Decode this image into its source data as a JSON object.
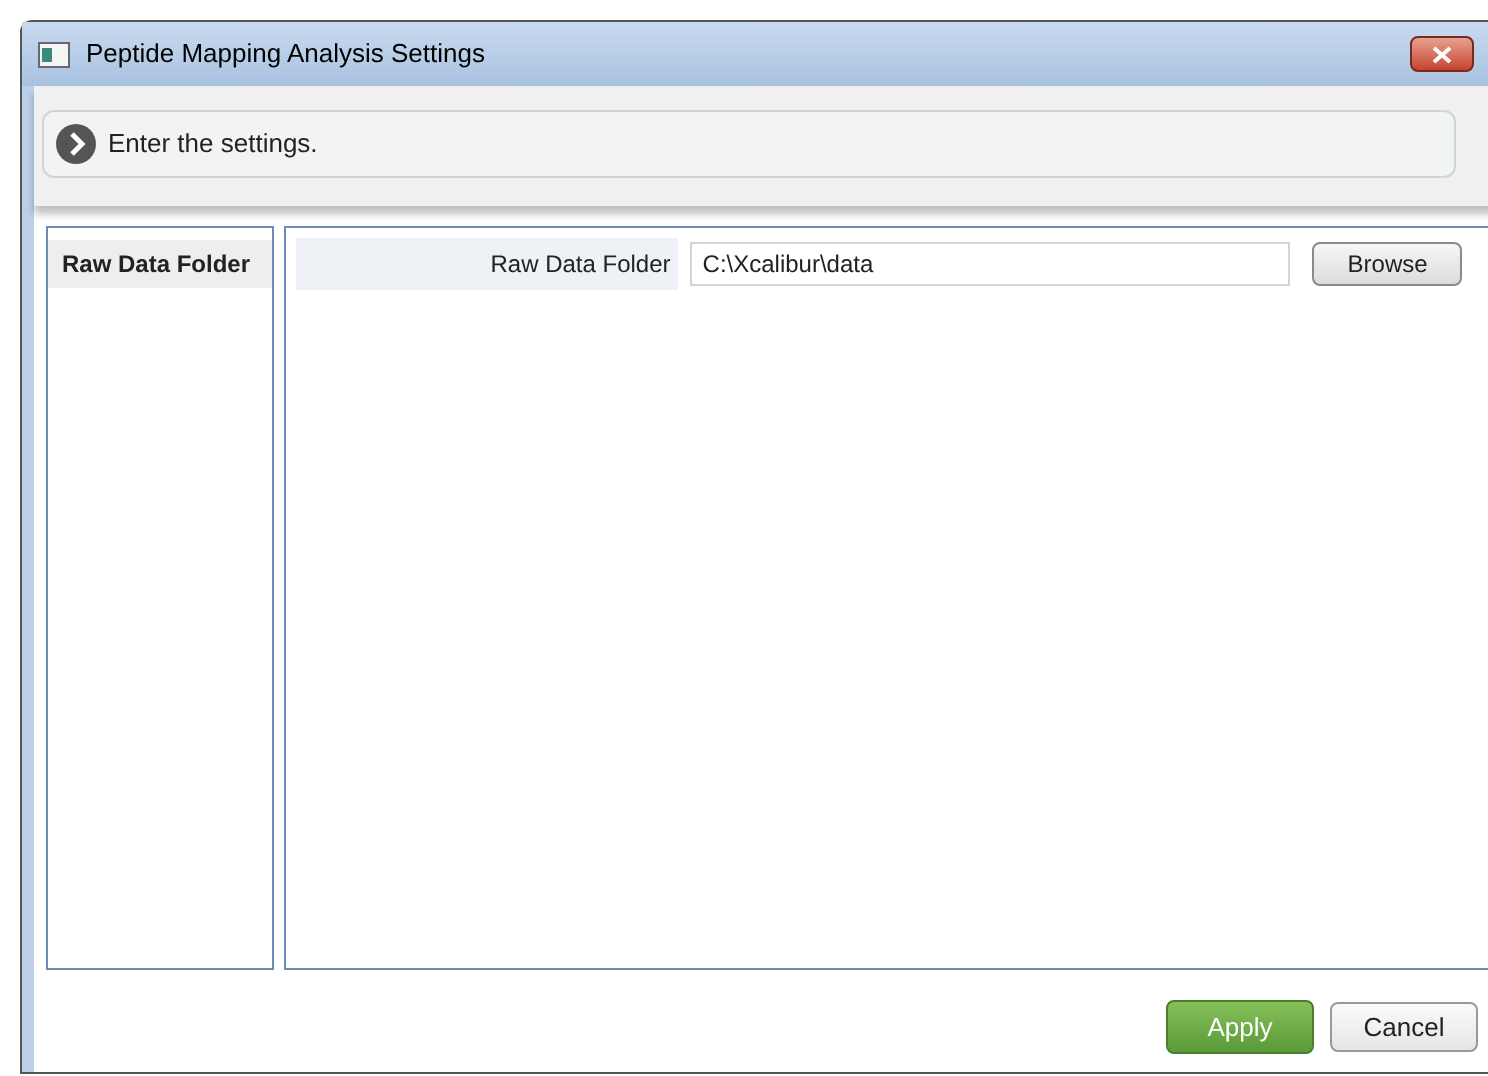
{
  "window": {
    "title": "Peptide Mapping Analysis Settings"
  },
  "info_bar": {
    "message": "Enter the settings."
  },
  "sidebar": {
    "items": [
      {
        "label": "Raw Data Folder",
        "selected": true
      }
    ]
  },
  "form": {
    "label": "Raw Data Folder",
    "value": "C:\\Xcalibur\\data",
    "browse_button": "Browse"
  },
  "buttons": {
    "apply": "Apply",
    "cancel": "Cancel"
  }
}
